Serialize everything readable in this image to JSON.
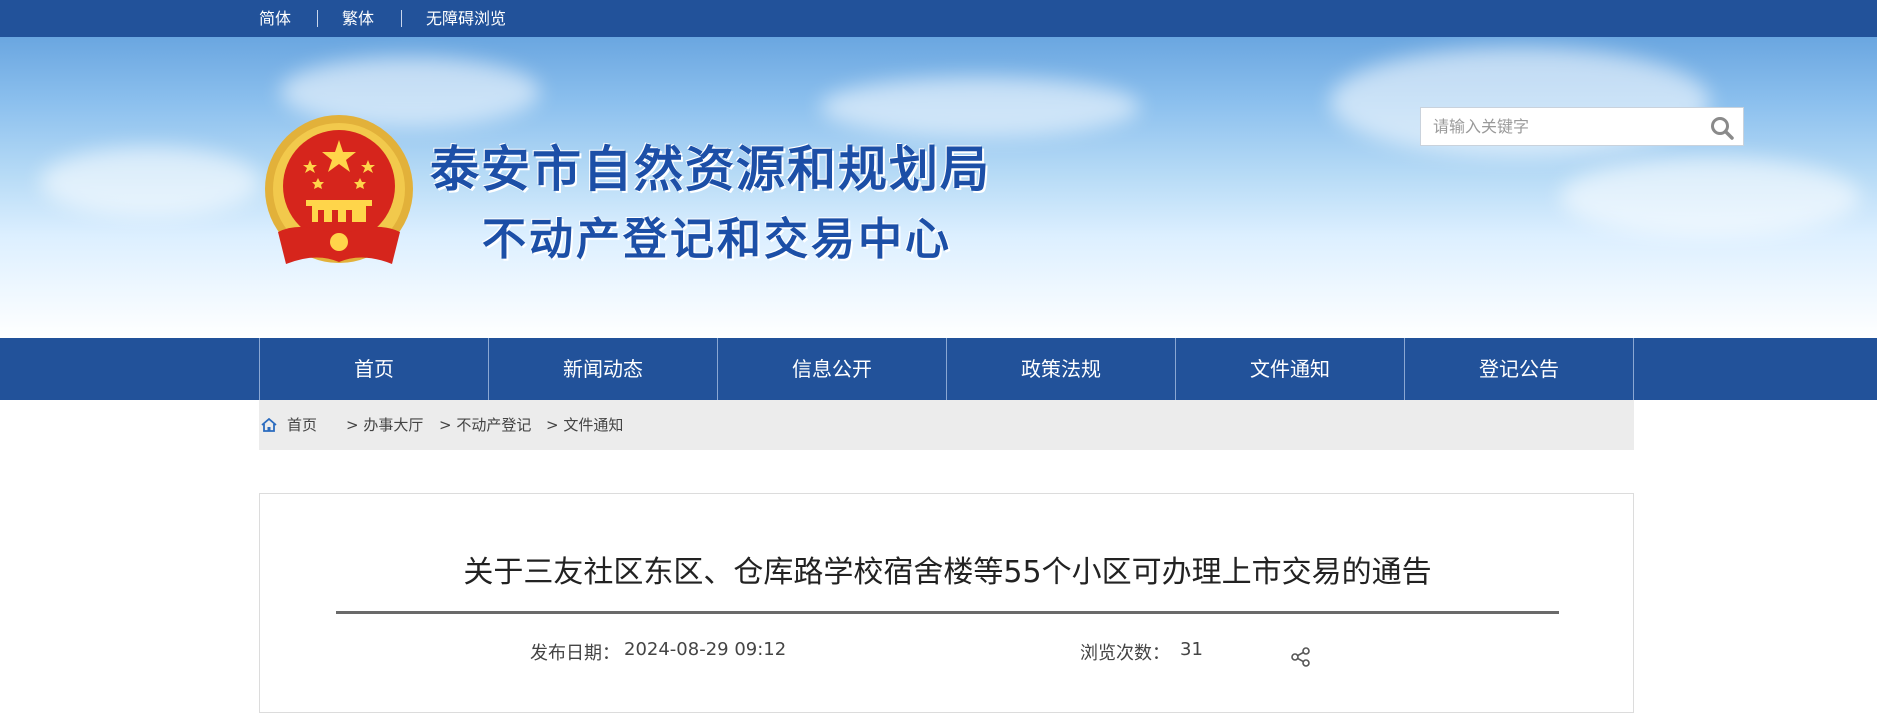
{
  "topbar": {
    "lang_simplified": "简体",
    "lang_traditional": "繁体",
    "accessibility": "无障碍浏览"
  },
  "header": {
    "title_line1": "泰安市自然资源和规划局",
    "title_line2": "不动产登记和交易中心",
    "emblem_icon": "national-emblem-icon"
  },
  "search": {
    "placeholder": "请输入关键字",
    "value": "",
    "icon": "search-icon"
  },
  "nav": {
    "items": [
      "首页",
      "新闻动态",
      "信息公开",
      "政策法规",
      "文件通知",
      "登记公告"
    ]
  },
  "breadcrumb": {
    "home_icon": "home-icon",
    "home": "首页",
    "path": [
      "> 办事大厅",
      "> 不动产登记",
      "> 文件通知"
    ]
  },
  "article": {
    "title": "关于三友社区东区、仓库路学校宿舍楼等55个小区可办理上市交易的通告",
    "publish_label": "发布日期：",
    "publish_date": "2024-08-29 09:12",
    "views_label": "浏览次数：",
    "views": "31",
    "share_icon": "share-icon"
  },
  "colors": {
    "brand_blue": "#22529a",
    "title_blue": "#1c4fa7",
    "breadcrumb_bg": "#ececec"
  }
}
